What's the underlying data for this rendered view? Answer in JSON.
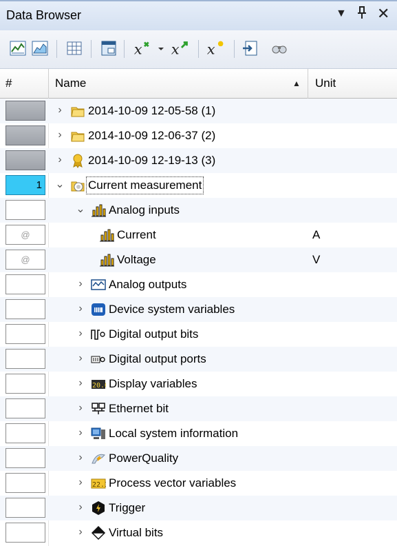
{
  "window": {
    "title": "Data Browser",
    "dropdown_glyph": "▼",
    "pin_glyph": "И",
    "close_glyph": "✕"
  },
  "toolbar": {
    "tools": [
      {
        "name": "line-chart-icon"
      },
      {
        "name": "area-chart-icon"
      },
      {
        "name": "table-view-icon"
      },
      {
        "name": "display-window-icon"
      },
      {
        "name": "add-formula-icon"
      },
      {
        "name": "formula-dropdown-icon"
      },
      {
        "name": "formula-up-icon"
      },
      {
        "name": "formula-new-icon"
      },
      {
        "name": "export-icon"
      },
      {
        "name": "binoculars-icon"
      }
    ]
  },
  "columns": {
    "number": "#",
    "name": "Name",
    "unit": "Unit",
    "sort_glyph": "▲"
  },
  "rows": [
    {
      "num": "",
      "num_style": "grey",
      "expander": "›",
      "icon": "folder-icon",
      "label": "2014-10-09 12-05-58 (1)",
      "unit": ""
    },
    {
      "num": "",
      "num_style": "grey",
      "expander": "›",
      "icon": "folder-icon",
      "label": "2014-10-09 12-06-37 (2)",
      "unit": ""
    },
    {
      "num": "",
      "num_style": "grey",
      "expander": "›",
      "icon": "award-icon",
      "label": "2014-10-09 12-19-13 (3)",
      "unit": ""
    },
    {
      "num": "1",
      "num_style": "blue",
      "expander": "⌄",
      "icon": "measurement-folder-icon",
      "label": "Current measurement",
      "unit": ""
    },
    {
      "num": "",
      "num_style": "empty",
      "expander": "⌄",
      "icon": "bar-chart-icon",
      "label": "Analog inputs",
      "unit": ""
    },
    {
      "num": "@",
      "num_style": "at",
      "expander": "",
      "icon": "bar-chart-icon",
      "label": "Current",
      "unit": "A"
    },
    {
      "num": "@",
      "num_style": "at",
      "expander": "",
      "icon": "bar-chart-icon",
      "label": "Voltage",
      "unit": "V"
    },
    {
      "num": "",
      "num_style": "empty",
      "expander": "›",
      "icon": "waveform-icon",
      "label": "Analog outputs",
      "unit": ""
    },
    {
      "num": "",
      "num_style": "empty",
      "expander": "›",
      "icon": "device-icon",
      "label": "Device system variables",
      "unit": ""
    },
    {
      "num": "",
      "num_style": "empty",
      "expander": "›",
      "icon": "pulse-icon",
      "label": "Digital output bits",
      "unit": ""
    },
    {
      "num": "",
      "num_style": "empty",
      "expander": "›",
      "icon": "port-icon",
      "label": "Digital output ports",
      "unit": ""
    },
    {
      "num": "",
      "num_style": "empty",
      "expander": "›",
      "icon": "display-icon",
      "label": "Display variables",
      "unit": ""
    },
    {
      "num": "",
      "num_style": "empty",
      "expander": "›",
      "icon": "ethernet-icon",
      "label": "Ethernet bit",
      "unit": ""
    },
    {
      "num": "",
      "num_style": "empty",
      "expander": "›",
      "icon": "computer-icon",
      "label": "Local system information",
      "unit": ""
    },
    {
      "num": "",
      "num_style": "empty",
      "expander": "›",
      "icon": "power-icon",
      "label": "PowerQuality",
      "unit": ""
    },
    {
      "num": "",
      "num_style": "empty",
      "expander": "›",
      "icon": "vector-icon",
      "label": "Process vector variables",
      "unit": ""
    },
    {
      "num": "",
      "num_style": "empty",
      "expander": "›",
      "icon": "trigger-icon",
      "label": "Trigger",
      "unit": ""
    },
    {
      "num": "",
      "num_style": "empty",
      "expander": "›",
      "icon": "virtual-bits-icon",
      "label": "Virtual bits",
      "unit": ""
    }
  ]
}
